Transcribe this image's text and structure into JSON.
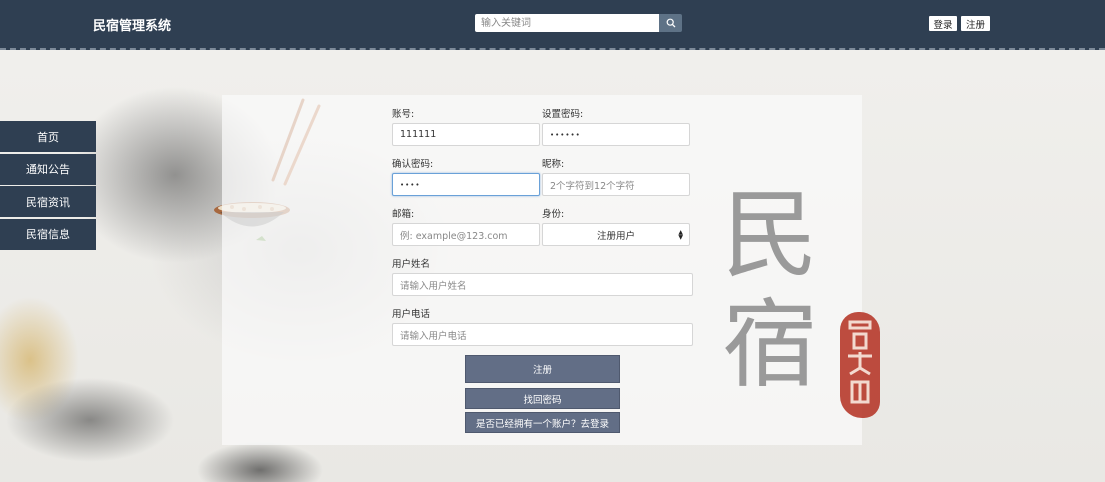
{
  "header": {
    "brand": "民宿管理系统",
    "search_placeholder": "输入关键词",
    "login_label": "登录",
    "register_label": "注册"
  },
  "sidebar": {
    "items": [
      {
        "label": "首页"
      },
      {
        "label": "通知公告"
      },
      {
        "label": "民宿资讯"
      },
      {
        "label": "民宿信息"
      }
    ]
  },
  "form": {
    "account": {
      "label": "账号:",
      "value": "111111"
    },
    "password": {
      "label": "设置密码:",
      "value": "••••••"
    },
    "confirm": {
      "label": "确认密码:",
      "value": "••••"
    },
    "nickname": {
      "label": "昵称:",
      "placeholder": "2个字符到12个字符"
    },
    "email": {
      "label": "邮箱:",
      "placeholder": "例: example@123.com"
    },
    "role": {
      "label": "身份:",
      "selected": "注册用户"
    },
    "username": {
      "label": "用户姓名",
      "placeholder": "请输入用户姓名"
    },
    "phone": {
      "label": "用户电话",
      "placeholder": "请输入用户电话"
    },
    "submit_label": "注册",
    "recover_label": "找回密码",
    "to_login_label": "是否已经拥有一个账户？去登录"
  },
  "decor": {
    "calligraphy_line1": "民",
    "calligraphy_line2": "宿",
    "seal_color": "#b73a2c"
  }
}
